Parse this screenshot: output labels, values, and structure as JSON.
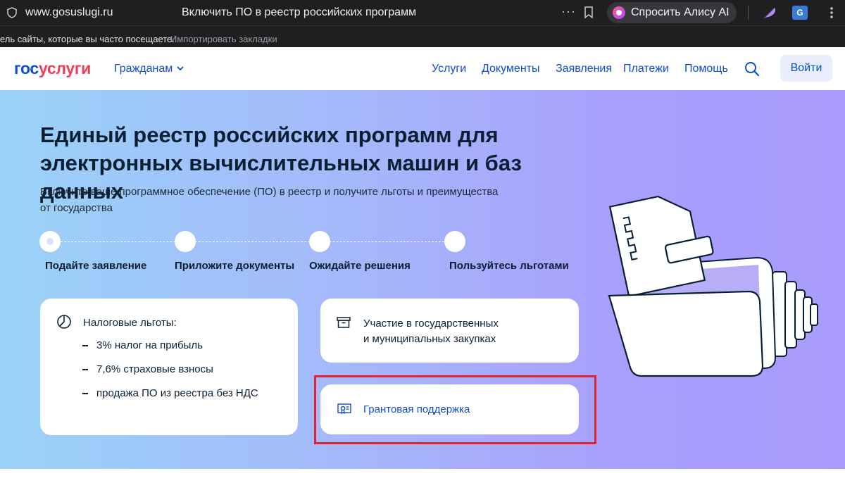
{
  "browser": {
    "url": "www.gosuslugi.ru",
    "tab_title": "Включить ПО в реестр российских программ",
    "more": "···",
    "alice_label": "Спросить Алису AI",
    "translate_glyph": "G",
    "bookmarks_text": "ель сайты, которые вы часто посещаете.",
    "bookmarks_import": "Импортировать закладки"
  },
  "header": {
    "logo_part1": "гос",
    "logo_part2": "услуги",
    "citizens": "Гражданам",
    "nav": [
      "Услуги",
      "Документы",
      "Заявления",
      "Платежи",
      "Помощь"
    ],
    "login": "Войти"
  },
  "hero": {
    "title_line1": "Единый реестр российских программ для",
    "title_line2": "электронных вычислительных машин и баз данных",
    "subtitle_line1": "Включите ваше программное обеспечение (ПО) в реестр и получите льготы и преимущества",
    "subtitle_line2": "от государства",
    "steps": [
      "Подайте заявление",
      "Приложите документы",
      "Ожидайте решения",
      "Пользуйтесь льготами"
    ]
  },
  "cards": {
    "tax": {
      "title": "Налоговые льготы:",
      "items": [
        "3% налог на прибыль",
        "7,6% страховые взносы",
        "продажа ПО из реестра без НДС"
      ]
    },
    "procurement": {
      "line1": "Участие в государственных",
      "line2": "и муниципальных закупках"
    },
    "grant": {
      "label": "Грантовая поддержка"
    }
  },
  "colors": {
    "brand_blue": "#0d4cd3",
    "brand_red": "#ee3f58",
    "highlight_red": "#e0242f"
  }
}
